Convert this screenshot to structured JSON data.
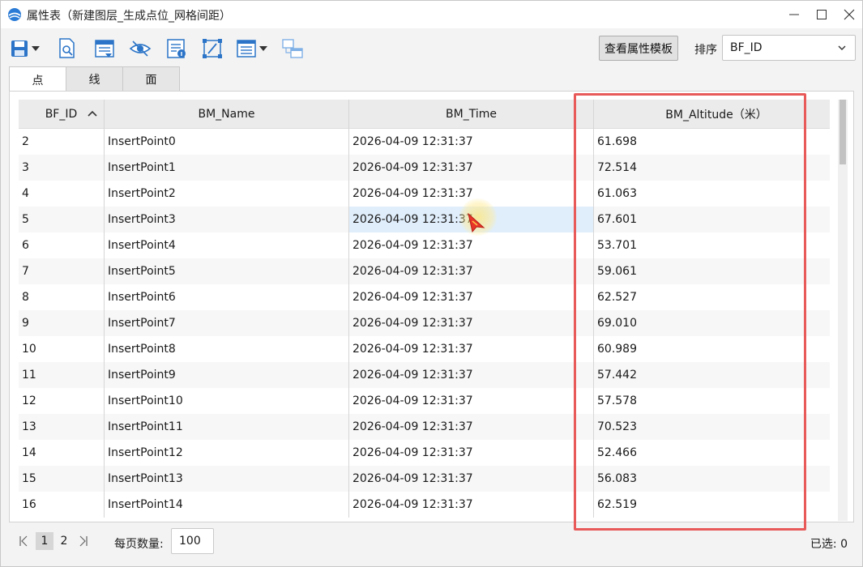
{
  "window": {
    "title": "属性表（新建图层_生成点位_网格间距）"
  },
  "toolbar": {
    "icons": [
      "save-icon",
      "dropdown-icon",
      "zoom-to-icon",
      "field-list-icon",
      "visibility-icon",
      "attribute-info-icon",
      "edit-shape-icon",
      "column-settings-icon",
      "dropdown-icon",
      "link-window-icon"
    ],
    "template_button": "查看属性模板",
    "sort_label": "排序",
    "sort_value": "BF_ID"
  },
  "tabs": [
    {
      "label": "点",
      "active": true
    },
    {
      "label": "线",
      "active": false
    },
    {
      "label": "面",
      "active": false
    }
  ],
  "table": {
    "columns": [
      "BF_ID",
      "BM_Name",
      "BM_Time",
      "BM_Altitude（米）"
    ],
    "rows": [
      {
        "id": "2",
        "name": "InsertPoint0",
        "time": "2026-04-09 12:31:37",
        "alt": "61.698"
      },
      {
        "id": "3",
        "name": "InsertPoint1",
        "time": "2026-04-09 12:31:37",
        "alt": "72.514"
      },
      {
        "id": "4",
        "name": "InsertPoint2",
        "time": "2026-04-09 12:31:37",
        "alt": "61.063"
      },
      {
        "id": "5",
        "name": "InsertPoint3",
        "time": "2026-04-09 12:31:37",
        "alt": "67.601"
      },
      {
        "id": "6",
        "name": "InsertPoint4",
        "time": "2026-04-09 12:31:37",
        "alt": "53.701"
      },
      {
        "id": "7",
        "name": "InsertPoint5",
        "time": "2026-04-09 12:31:37",
        "alt": "59.061"
      },
      {
        "id": "8",
        "name": "InsertPoint6",
        "time": "2026-04-09 12:31:37",
        "alt": "62.527"
      },
      {
        "id": "9",
        "name": "InsertPoint7",
        "time": "2026-04-09 12:31:37",
        "alt": "69.010"
      },
      {
        "id": "10",
        "name": "InsertPoint8",
        "time": "2026-04-09 12:31:37",
        "alt": "60.989"
      },
      {
        "id": "11",
        "name": "InsertPoint9",
        "time": "2026-04-09 12:31:37",
        "alt": "57.442"
      },
      {
        "id": "12",
        "name": "InsertPoint10",
        "time": "2026-04-09 12:31:37",
        "alt": "57.578"
      },
      {
        "id": "13",
        "name": "InsertPoint11",
        "time": "2026-04-09 12:31:37",
        "alt": "70.523"
      },
      {
        "id": "14",
        "name": "InsertPoint12",
        "time": "2026-04-09 12:31:37",
        "alt": "52.466"
      },
      {
        "id": "15",
        "name": "InsertPoint13",
        "time": "2026-04-09 12:31:37",
        "alt": "56.083"
      },
      {
        "id": "16",
        "name": "InsertPoint14",
        "time": "2026-04-09 12:31:37",
        "alt": "62.519"
      }
    ]
  },
  "pager": {
    "pages": [
      "1",
      "2"
    ],
    "current_page": "1",
    "per_page_label": "每页数量:",
    "per_page_value": "100",
    "selected_text": "已选:  0"
  },
  "colors": {
    "highlight": "#e85a5a",
    "selected_cell": "#e0eefb",
    "header_bg": "#ebebeb"
  }
}
